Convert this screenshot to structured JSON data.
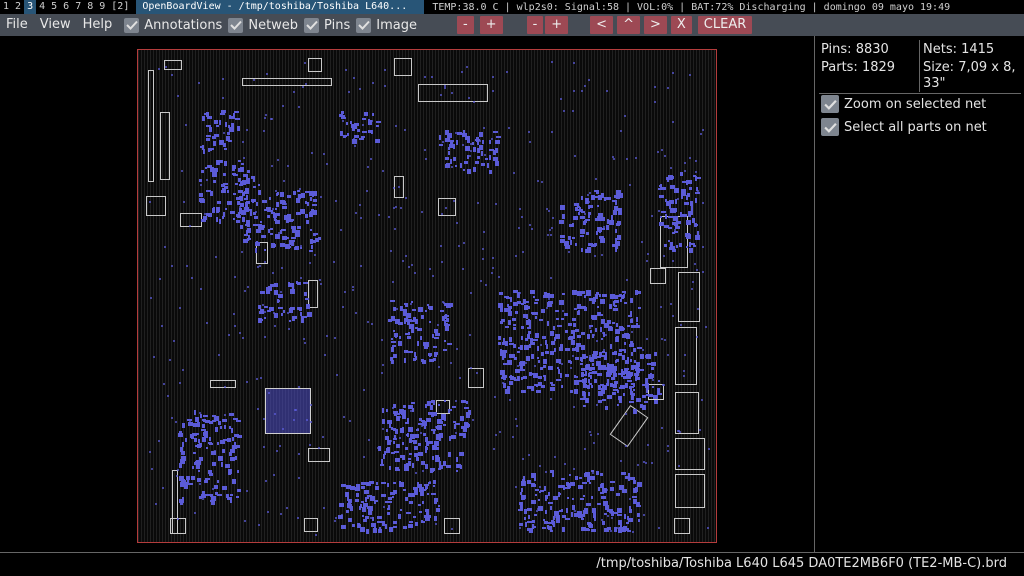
{
  "i3bar": {
    "workspaces": [
      "1",
      "2",
      "3",
      "4",
      "5",
      "6",
      "7",
      "8",
      "9",
      "[2]"
    ],
    "active_workspace": "3",
    "window_title": "OpenBoardView - /tmp/toshiba/Toshiba L640...",
    "status": "TEMP:38.0 C | wlp2s0: Signal:58 | VOL:0% | BAT:72% Discharging | domingo 09 mayo 19:49"
  },
  "menubar": {
    "menus": [
      "File",
      "View",
      "Help"
    ],
    "toggles": [
      {
        "label": "Annotations",
        "checked": true
      },
      {
        "label": "Netweb",
        "checked": true
      },
      {
        "label": "Pins",
        "checked": true
      },
      {
        "label": "Image",
        "checked": true
      }
    ],
    "buttons": [
      "-",
      "+",
      "-",
      "+",
      "<",
      "^",
      ">",
      "X"
    ],
    "clear_label": "CLEAR",
    "button_color": "#9d4954"
  },
  "panel": {
    "pins": "Pins: 8830",
    "parts": "Parts: 1829",
    "nets": "Nets: 1415",
    "size_line1": "Size: 7,09 x 8,",
    "size_line2": "33\"",
    "options": [
      {
        "label": "Zoom on selected net",
        "checked": true
      },
      {
        "label": "Select all parts on net",
        "checked": true
      }
    ]
  },
  "status_bar": {
    "file_path": "/tmp/toshiba/Toshiba L640 L645 DA0TE2MB6F0 (TE2-MB-C).brd"
  },
  "colors": {
    "board_outline": "#b43c3c",
    "pad": "#5b5bd8",
    "component_outline": "#c9c9c9",
    "menubar": "#464c55"
  }
}
